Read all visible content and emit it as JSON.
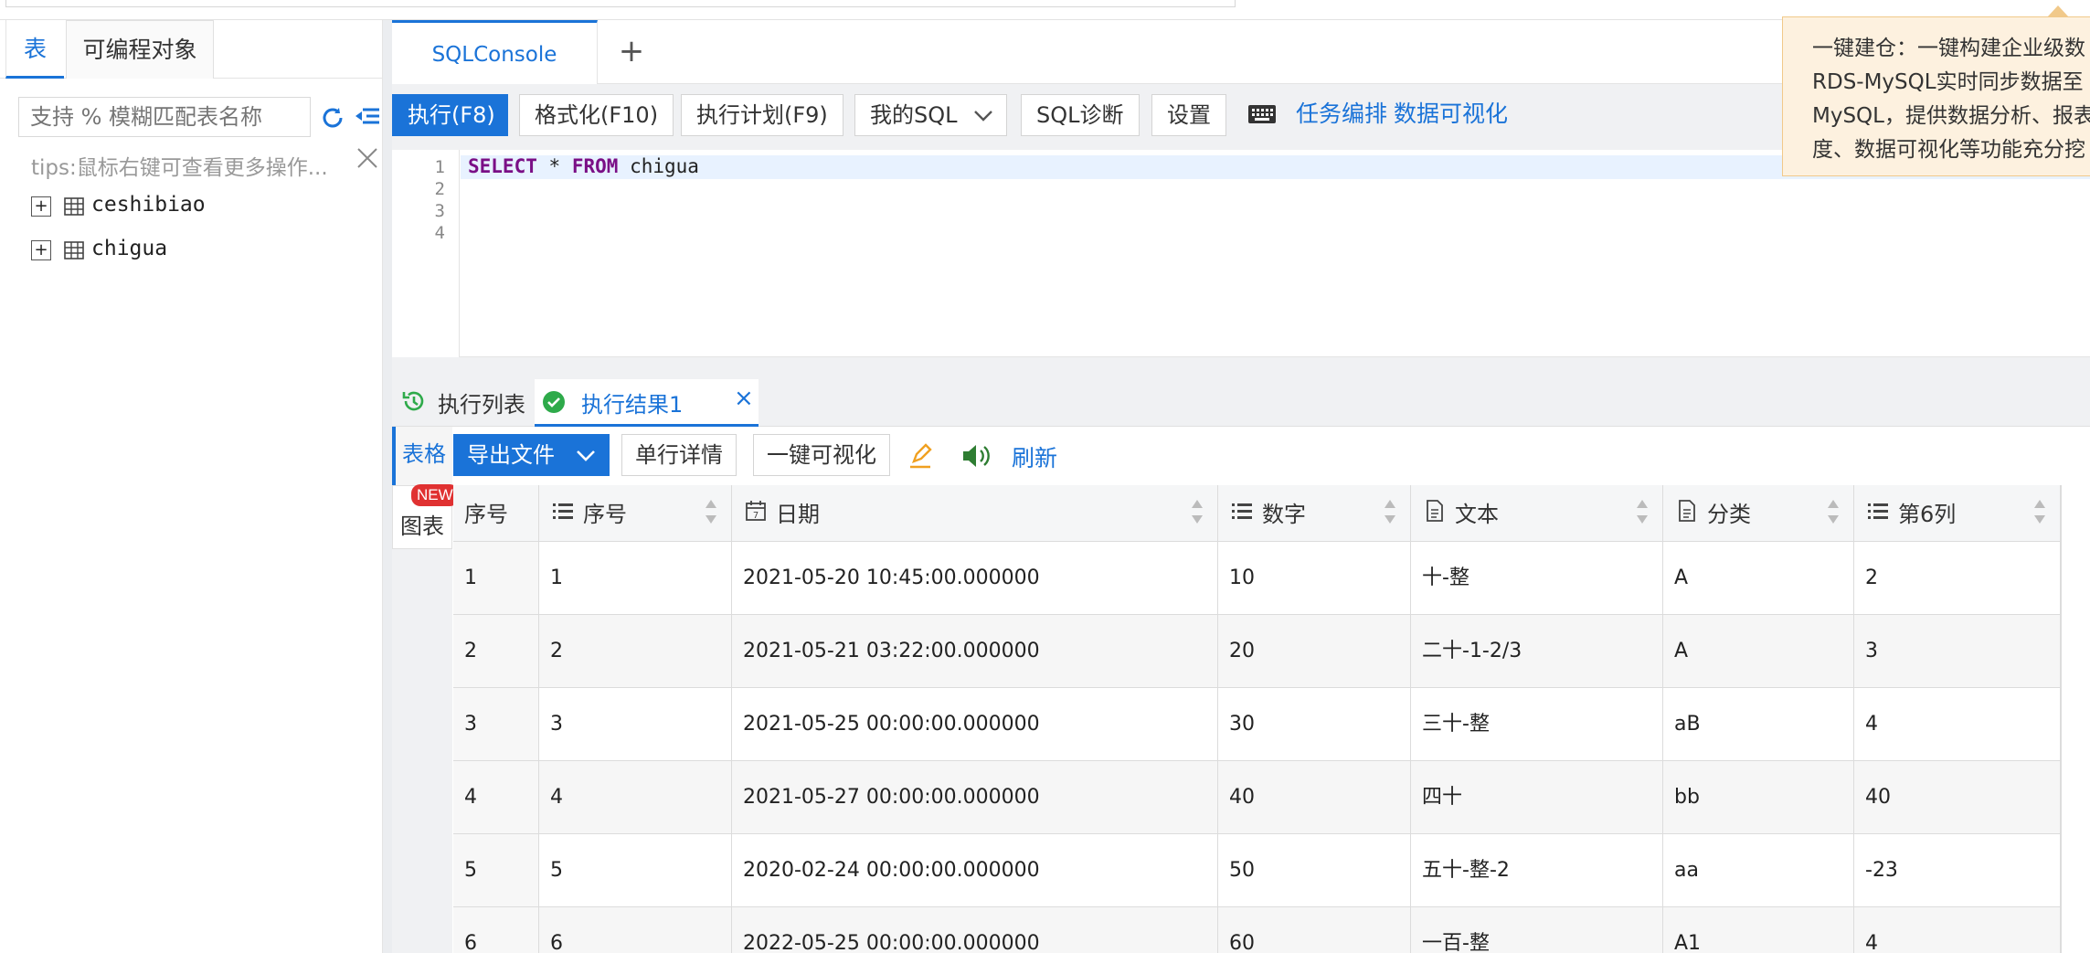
{
  "left_panel": {
    "tabs": [
      "表",
      "可编程对象"
    ],
    "search_placeholder": "支持 % 模糊匹配表名称",
    "tips": "tips:鼠标右键可查看更多操作...",
    "tables": [
      "ceshibiao",
      "chigua"
    ]
  },
  "console_tab": {
    "label": "SQLConsole",
    "add_label": "+"
  },
  "toolbar": {
    "execute": "执行(F8)",
    "format": "格式化(F10)",
    "plan": "执行计划(F9)",
    "my_sql": "我的SQL",
    "diagnose": "SQL诊断",
    "settings": "设置",
    "task_schedule": "任务编排",
    "data_viz": "数据可视化"
  },
  "editor": {
    "line_numbers": [
      "1",
      "2",
      "3",
      "4"
    ],
    "keyword_select": "SELECT",
    "star": "*",
    "keyword_from": "FROM",
    "table": "chigua"
  },
  "result_tabs": {
    "history": "执行列表",
    "result": "执行结果1",
    "close": "×"
  },
  "result_toolbar": {
    "table_view": "表格",
    "export": "导出文件",
    "row_detail": "单行详情",
    "one_click_viz": "一键可视化",
    "refresh": "刷新",
    "chart_view": "图表",
    "new_badge": "NEW"
  },
  "grid": {
    "columns": [
      {
        "label": "序号",
        "type": "rownum"
      },
      {
        "label": "序号",
        "type": "number"
      },
      {
        "label": "日期",
        "type": "date"
      },
      {
        "label": "数字",
        "type": "number"
      },
      {
        "label": "文本",
        "type": "text"
      },
      {
        "label": "分类",
        "type": "text"
      },
      {
        "label": "第6列",
        "type": "number"
      }
    ],
    "rows": [
      [
        "1",
        "1",
        "2021-05-20 10:45:00.000000",
        "10",
        "十-整",
        "A",
        "2"
      ],
      [
        "2",
        "2",
        "2021-05-21 03:22:00.000000",
        "20",
        "二十-1-2/3",
        "A",
        "3"
      ],
      [
        "3",
        "3",
        "2021-05-25 00:00:00.000000",
        "30",
        "三十-整",
        "aB",
        "4"
      ],
      [
        "4",
        "4",
        "2021-05-27 00:00:00.000000",
        "40",
        "四十",
        "bb",
        "40"
      ],
      [
        "5",
        "5",
        "2020-02-24 00:00:00.000000",
        "50",
        "五十-整-2",
        "aa",
        "-23"
      ],
      [
        "6",
        "6",
        "2022-05-25 00:00:00.000000",
        "60",
        "一百-整",
        "A1",
        "4"
      ]
    ]
  },
  "tooltip": {
    "lines": [
      "一键建仓：一键构建企业级数",
      "RDS-MySQL实时同步数据至",
      "MySQL，提供数据分析、报表",
      "度、数据可视化等功能充分挖"
    ]
  },
  "colors": {
    "accent": "#1a73d8",
    "keyword": "#7a0f86",
    "success": "#2eaa4a",
    "tooltip_bg": "#fdf1df"
  }
}
